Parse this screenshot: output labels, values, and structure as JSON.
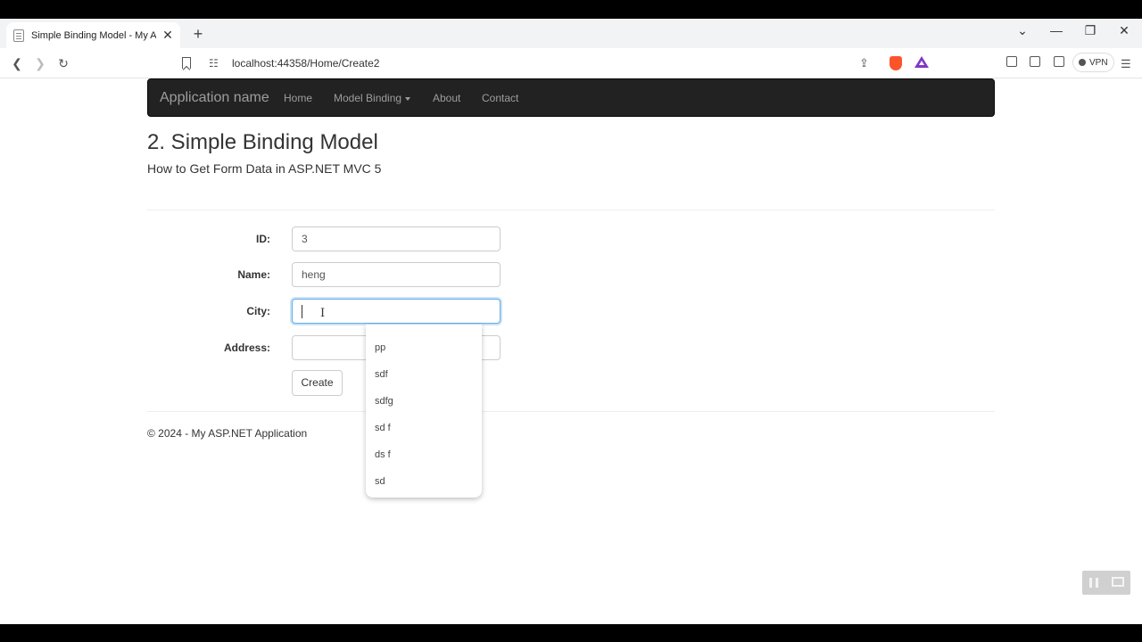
{
  "browser": {
    "tab": {
      "title": "Simple Binding Model - My ASP",
      "close": "✕"
    },
    "new_tab": "+",
    "window_controls": {
      "dropdown": "⌄",
      "minimize": "—",
      "restore": "❐",
      "close": "✕"
    },
    "nav": {
      "back": "❮",
      "forward": "❯",
      "reload": "↻"
    },
    "url": "localhost:44358/Home/Create2",
    "vpn_label": "VPN"
  },
  "navbar": {
    "brand": "Application name",
    "links": {
      "home": "Home",
      "model_binding": "Model Binding",
      "about": "About",
      "contact": "Contact"
    }
  },
  "page": {
    "title": "2. Simple Binding Model",
    "subtitle": "How to Get Form Data in ASP.NET MVC 5"
  },
  "form": {
    "id": {
      "label": "ID:",
      "value": "3"
    },
    "name": {
      "label": "Name:",
      "value": "heng"
    },
    "city": {
      "label": "City:",
      "value": ""
    },
    "address": {
      "label": "Address:",
      "value": ""
    },
    "submit_label": "Create"
  },
  "autocomplete": {
    "items": [
      "pp",
      "sdf",
      "sdfg",
      "sd f",
      "ds f",
      "sd"
    ]
  },
  "footer": {
    "text": "© 2024 - My ASP.NET Application"
  }
}
